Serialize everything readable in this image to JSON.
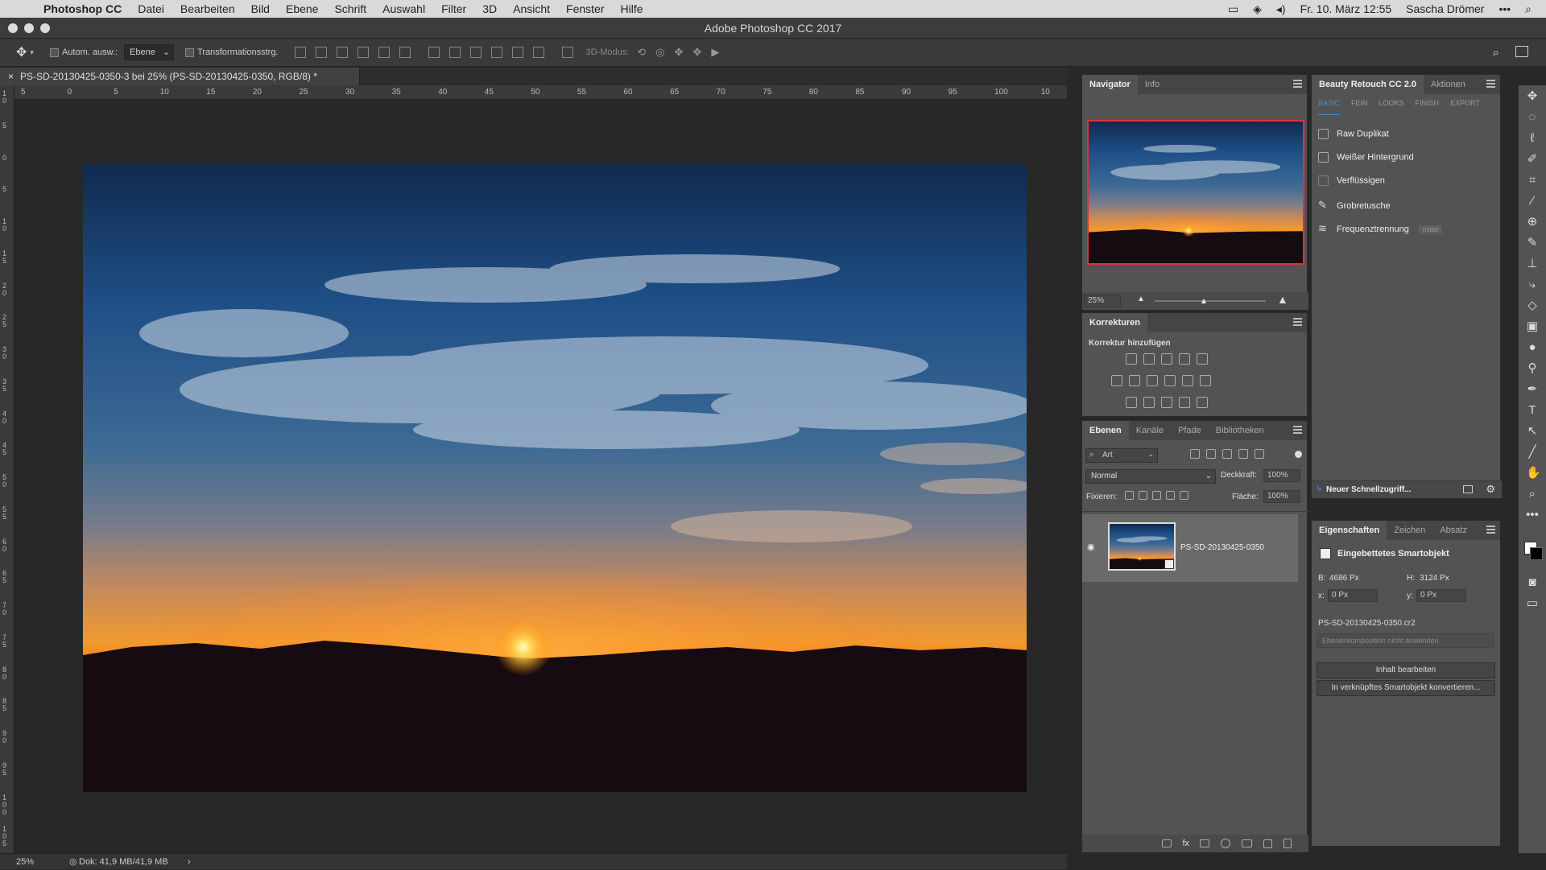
{
  "menubar": {
    "app": "Photoshop CC",
    "items": [
      "Datei",
      "Bearbeiten",
      "Bild",
      "Ebene",
      "Schrift",
      "Auswahl",
      "Filter",
      "3D",
      "Ansicht",
      "Fenster",
      "Hilfe"
    ],
    "datetime": "Fr. 10. März 12:55",
    "user": "Sascha Drömer"
  },
  "window": {
    "title": "Adobe Photoshop CC 2017"
  },
  "options": {
    "auto_select_label": "Autom. ausw.:",
    "auto_select_value": "Ebene",
    "transform_label": "Transformationsstrg.",
    "mode_label": "3D-Modus:"
  },
  "document": {
    "tab_title": "PS-SD-20130425-0350-3 bei 25% (PS-SD-20130425-0350, RGB/8) *",
    "zoom": "25%",
    "doc_info": "Dok: 41,9 MB/41,9 MB"
  },
  "ruler": {
    "h_ticks": [
      "5",
      "0",
      "5",
      "10",
      "15",
      "20",
      "25",
      "30",
      "35",
      "40",
      "45",
      "50",
      "55",
      "60",
      "65",
      "70",
      "75",
      "80",
      "85",
      "90",
      "95",
      "100",
      "10"
    ],
    "v_ticks": [
      "1\n0",
      "5",
      "0",
      "5",
      "1\n0",
      "1\n5",
      "2\n0",
      "2\n5",
      "3\n0",
      "3\n5",
      "4\n0",
      "4\n5",
      "5\n0",
      "5\n5",
      "6\n0",
      "6\n5",
      "7\n0",
      "7\n5",
      "8\n0",
      "8\n5",
      "9\n0",
      "9\n5",
      "1\n0\n0",
      "1\n0\n5"
    ]
  },
  "navigator": {
    "tabs": [
      "Navigator",
      "Info"
    ],
    "zoom": "25%"
  },
  "corrections": {
    "title": "Korrekturen",
    "subtitle": "Korrektur hinzufügen"
  },
  "layers": {
    "tabs": [
      "Ebenen",
      "Kanäle",
      "Pfade",
      "Bibliotheken"
    ],
    "filter_placeholder": "Art",
    "blend_mode": "Normal",
    "opacity_label": "Deckkraft:",
    "opacity_value": "100%",
    "lock_label": "Fixieren:",
    "fill_label": "Fläche:",
    "fill_value": "100%",
    "items": [
      {
        "name": "PS-SD-20130425-0350"
      }
    ]
  },
  "beauty": {
    "tabs": [
      "Beauty Retouch CC 2.0",
      "Aktionen"
    ],
    "subtabs": [
      "BASIC",
      "FEIN",
      "LOOKS",
      "FINISH",
      "EXPORT"
    ],
    "items": [
      "Raw Duplikat",
      "Weißer Hintergrund",
      "Verflüssigen",
      "Grobretusche",
      "Frequenztrennung"
    ],
    "badge": "mittel",
    "quick_access": "Neuer Schnellzugriff..."
  },
  "properties": {
    "tabs": [
      "Eigenschaften",
      "Zeichen",
      "Absatz"
    ],
    "type_label": "Eingebettetes Smartobjekt",
    "w_label": "B:",
    "w_value": "4686 Px",
    "h_label": "H:",
    "h_value": "3124 Px",
    "x_label": "x:",
    "x_value": "0 Px",
    "y_label": "y:",
    "y_value": "0 Px",
    "filename": "PS-SD-20130425-0350.cr2",
    "comp_placeholder": "Ebenenkomposition nicht anwenden",
    "edit_button": "Inhalt bearbeiten",
    "convert_button": "In verknüpftes Smartobjekt konvertieren..."
  },
  "colors": {
    "panel_bg": "#535353",
    "tab_bg": "#454545",
    "workspace": "#282828",
    "navigator_frame": "#e0303a",
    "accent_blue": "#3c8fd6"
  }
}
